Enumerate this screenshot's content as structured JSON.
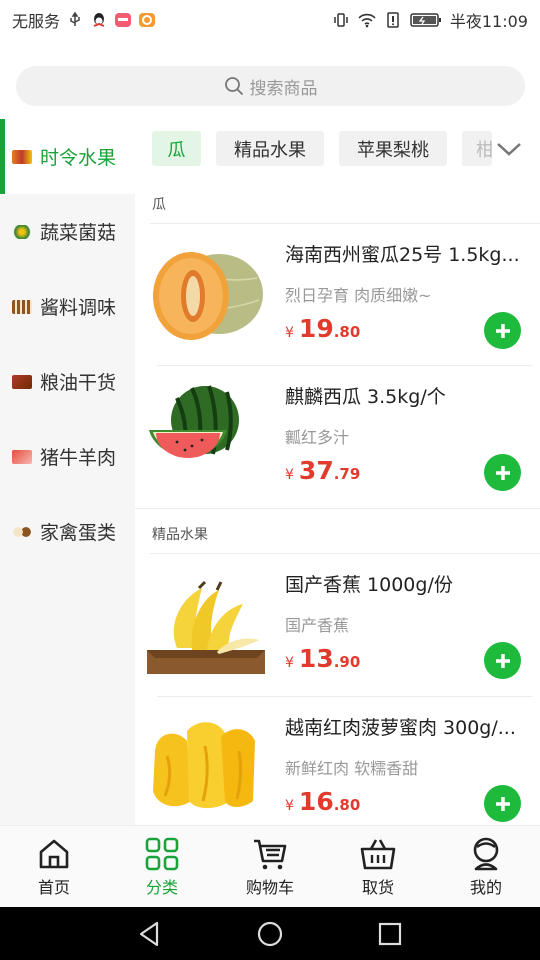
{
  "status_bar": {
    "carrier": "无服务",
    "time": "半夜11:09"
  },
  "search": {
    "placeholder": "搜索商品"
  },
  "sidebar": {
    "items": [
      {
        "label": "时令水果",
        "active": true
      },
      {
        "label": "蔬菜菌菇",
        "active": false
      },
      {
        "label": "酱料调味",
        "active": false
      },
      {
        "label": "粮油干货",
        "active": false
      },
      {
        "label": "猪牛羊肉",
        "active": false
      },
      {
        "label": "家禽蛋类",
        "active": false
      }
    ]
  },
  "tabs": {
    "items": [
      {
        "label": "瓜",
        "active": true
      },
      {
        "label": "精品水果",
        "active": false
      },
      {
        "label": "苹果梨桃",
        "active": false
      },
      {
        "label": "柑",
        "active": false
      }
    ]
  },
  "sections": [
    {
      "label": "瓜",
      "products": [
        {
          "title": "海南西州蜜瓜25号 1.5kg...",
          "subtitle": "烈日孕育 肉质细嫩~",
          "currency": "¥",
          "price_int": "19",
          "price_dec": ".80",
          "image": "hami-melon"
        },
        {
          "title": "麒麟西瓜   3.5kg/个",
          "subtitle": "瓤红多汁",
          "currency": "¥",
          "price_int": "37",
          "price_dec": ".79",
          "image": "watermelon"
        }
      ]
    },
    {
      "label": "精品水果",
      "products": [
        {
          "title": "国产香蕉   1000g/份",
          "subtitle": "国产香蕉",
          "currency": "¥",
          "price_int": "13",
          "price_dec": ".90",
          "image": "banana"
        },
        {
          "title": "越南红肉菠萝蜜肉 300g/...",
          "subtitle": "新鲜红肉 软糯香甜",
          "currency": "¥",
          "price_int": "16",
          "price_dec": ".80",
          "image": "jackfruit"
        }
      ]
    }
  ],
  "bottom_nav": {
    "items": [
      {
        "label": "首页",
        "icon": "home-icon",
        "active": false
      },
      {
        "label": "分类",
        "icon": "grid-icon",
        "active": true
      },
      {
        "label": "购物车",
        "icon": "cart-icon",
        "active": false
      },
      {
        "label": "取货",
        "icon": "basket-icon",
        "active": false
      },
      {
        "label": "我的",
        "icon": "profile-icon",
        "active": false
      }
    ]
  },
  "colors": {
    "accent": "#1aa339",
    "price": "#e23b2e",
    "add_button": "#1dba3c"
  }
}
